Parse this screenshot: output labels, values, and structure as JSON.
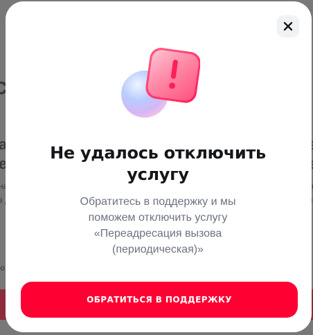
{
  "background": {
    "left_big": "с",
    "left_line_1": "а",
    "left_line_2": "е",
    "left_small_1": "на",
    "left_small_2": "з д",
    "left_small_3": "ю",
    "right_line_1": "а",
    "right_line_2": "е",
    "right_small_1": "на",
    "right_small_2": "з д"
  },
  "modal": {
    "close_icon": "close-icon",
    "illustration": "warning-exclamation-illustration",
    "title_line_1": "Не удалось отключить",
    "title_line_2": "услугу",
    "description_lines": [
      "Обратитесь в поддержку и мы",
      "поможем отключить услугу",
      "«Переадресация вызова",
      "(периодическая)»"
    ],
    "cta_label": "ОБРАТИТЬСЯ В ПОДДЕРЖКУ"
  },
  "colors": {
    "accent": "#ff0032",
    "title": "#14161a",
    "description": "#6c7280",
    "close_bg": "#f1f2f4"
  }
}
